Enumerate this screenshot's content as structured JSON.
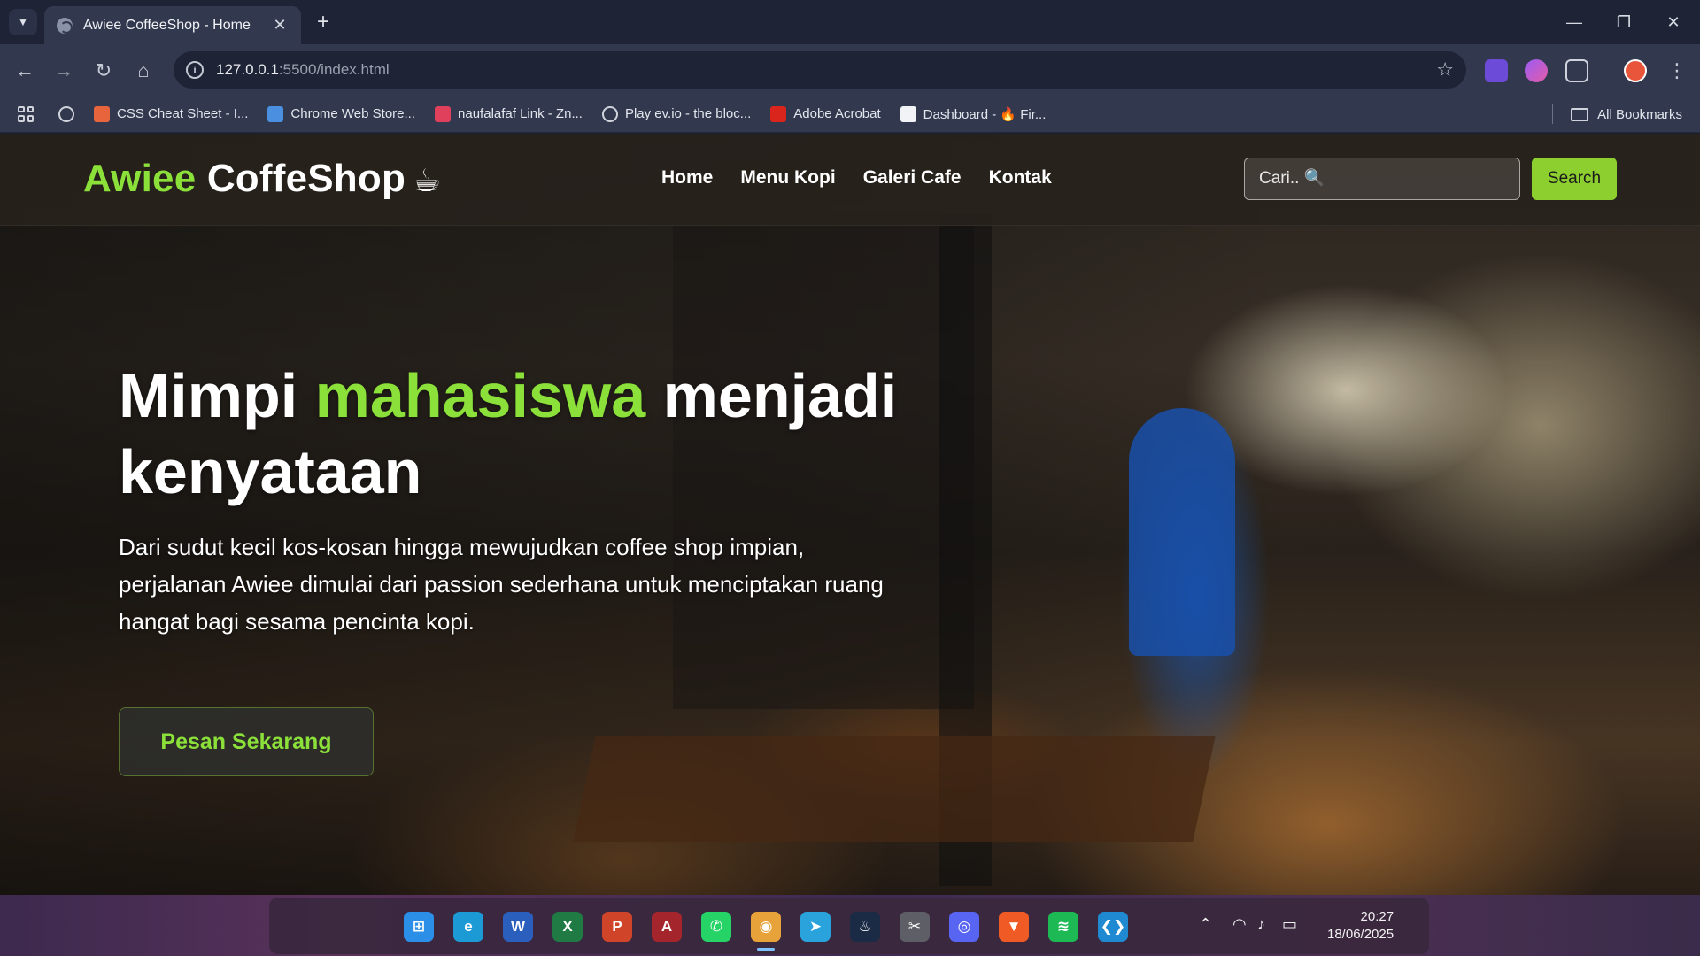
{
  "browser": {
    "tab_title": "Awiee CoffeeShop - Home",
    "tab_close": "✕",
    "new_tab": "+",
    "url_host": "127.0.0.1",
    "url_path": ":5500/index.html",
    "window_controls": {
      "minimize": "—",
      "restore": "❐",
      "close": "✕"
    },
    "bookmarks": [
      {
        "label": "CSS Cheat Sheet - I...",
        "color": "#e8643c"
      },
      {
        "label": "Chrome Web Store...",
        "color": "#4a8fe0"
      },
      {
        "label": "naufalafaf Link - Zn...",
        "color": "#e0405c"
      },
      {
        "label": "Play ev.io - the bloc...",
        "color": "#1e2336"
      },
      {
        "label": "Adobe Acrobat",
        "color": "#d9251c"
      },
      {
        "label": "Dashboard - 🔥 Fir...",
        "color": "#f1f3f6"
      }
    ],
    "all_bookmarks": "All Bookmarks"
  },
  "site": {
    "logo_accent": "Awiee",
    "logo_rest": "CoffeShop",
    "logo_icon": "☕",
    "nav": [
      "Home",
      "Menu Kopi",
      "Galeri Cafe",
      "Kontak"
    ],
    "search_placeholder": "Cari.. 🔍",
    "search_button": "Search"
  },
  "hero": {
    "title_part1": "Mimpi ",
    "title_accent": "mahasiswa",
    "title_part2": " menjadi kenyataan",
    "description": "Dari sudut kecil kos-kosan hingga mewujudkan coffee shop impian, perjalanan Awiee dimulai dari passion sederhana untuk menciptakan ruang hangat bagi sesama pencinta kopi.",
    "cta": "Pesan Sekarang"
  },
  "taskbar": {
    "apps": [
      {
        "name": "windows-start",
        "label": "⊞",
        "color": "#2b8fe8"
      },
      {
        "name": "edge",
        "label": "e",
        "color": "#1c9ad6"
      },
      {
        "name": "word",
        "label": "W",
        "color": "#2b5fbd"
      },
      {
        "name": "excel",
        "label": "X",
        "color": "#1f7a44"
      },
      {
        "name": "powerpoint",
        "label": "P",
        "color": "#d0452a"
      },
      {
        "name": "access",
        "label": "A",
        "color": "#a4262c"
      },
      {
        "name": "whatsapp",
        "label": "✆",
        "color": "#25d366"
      },
      {
        "name": "chrome",
        "label": "◉",
        "color": "#e8a23a"
      },
      {
        "name": "telegram",
        "label": "➤",
        "color": "#2aa3dc"
      },
      {
        "name": "steam",
        "label": "♨",
        "color": "#1b2a45"
      },
      {
        "name": "tools",
        "label": "✂",
        "color": "#5e5e66"
      },
      {
        "name": "discord",
        "label": "◎",
        "color": "#5865f2"
      },
      {
        "name": "brave",
        "label": "▼",
        "color": "#f05a24"
      },
      {
        "name": "spotify",
        "label": "≋",
        "color": "#1db954"
      },
      {
        "name": "vscode",
        "label": "❮❯",
        "color": "#1f8ad2"
      }
    ],
    "time": "20:27",
    "date": "18/06/2025"
  }
}
